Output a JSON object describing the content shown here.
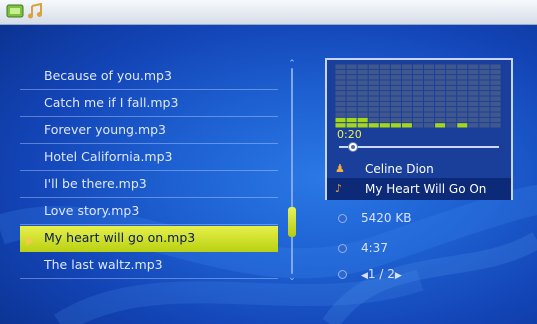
{
  "colors": {
    "accent_selected": "#d4e32a",
    "background": "#1d5fd0",
    "time_text": "#e8f05a"
  },
  "topbar": {
    "icons": [
      "photo-icon",
      "music-icon"
    ]
  },
  "playlist": {
    "items": [
      {
        "label": "Because of you.mp3"
      },
      {
        "label": "Catch me if I fall.mp3"
      },
      {
        "label": "Forever young.mp3"
      },
      {
        "label": "Hotel California.mp3"
      },
      {
        "label": "I'll be there.mp3"
      },
      {
        "label": "Love story.mp3"
      },
      {
        "label": "My heart will go on.mp3"
      },
      {
        "label": "The last waltz.mp3"
      }
    ],
    "selected_index": 6
  },
  "now_playing": {
    "elapsed": "0:20",
    "progress_fraction": 0.09,
    "artist": "Celine Dion",
    "title": "My Heart Will Go On",
    "spectrum_levels": [
      0.2,
      0.2,
      0.15,
      0.12,
      0.08,
      0.05,
      0.05,
      0.03,
      0.04,
      0.06,
      0.03,
      0.05,
      0.04,
      0.03,
      0.02
    ]
  },
  "file_info": {
    "size": "5420 KB",
    "duration": "4:37",
    "page": "1 / 2"
  }
}
